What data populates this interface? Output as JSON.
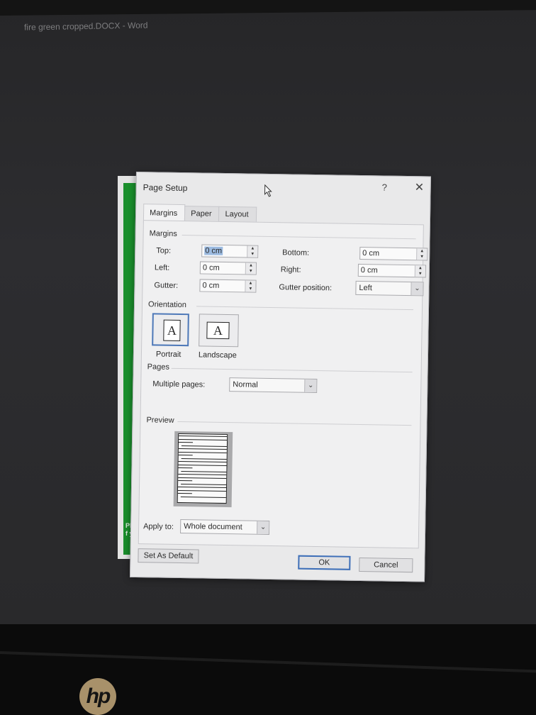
{
  "window": {
    "app_title": "fire green cropped.DOCX - Word"
  },
  "document_fragment": {
    "lines": [
      "Plea",
      "f you"
    ],
    "accent_color": "#1a8f2c"
  },
  "dialog": {
    "title": "Page Setup",
    "help_label": "?",
    "close_label": "✕",
    "tabs": [
      {
        "label": "Margins",
        "active": true
      },
      {
        "label": "Paper",
        "active": false
      },
      {
        "label": "Layout",
        "active": false
      }
    ],
    "margins": {
      "heading": "Margins",
      "top": {
        "label": "Top:",
        "value": "0 cm"
      },
      "bottom": {
        "label": "Bottom:",
        "value": "0 cm"
      },
      "left": {
        "label": "Left:",
        "value": "0 cm"
      },
      "right": {
        "label": "Right:",
        "value": "0 cm"
      },
      "gutter": {
        "label": "Gutter:",
        "value": "0 cm"
      },
      "gutter_position": {
        "label": "Gutter position:",
        "value": "Left"
      }
    },
    "orientation": {
      "heading": "Orientation",
      "portrait_label": "Portrait",
      "landscape_label": "Landscape",
      "icon_letter": "A",
      "selected": "Portrait"
    },
    "pages": {
      "heading": "Pages",
      "multiple_pages_label": "Multiple pages:",
      "multiple_pages_value": "Normal"
    },
    "preview": {
      "heading": "Preview"
    },
    "apply_to": {
      "label": "Apply to:",
      "value": "Whole document"
    },
    "buttons": {
      "set_default": "Set As Default",
      "ok": "OK",
      "cancel": "Cancel"
    }
  },
  "monitor": {
    "brand": "hp"
  }
}
